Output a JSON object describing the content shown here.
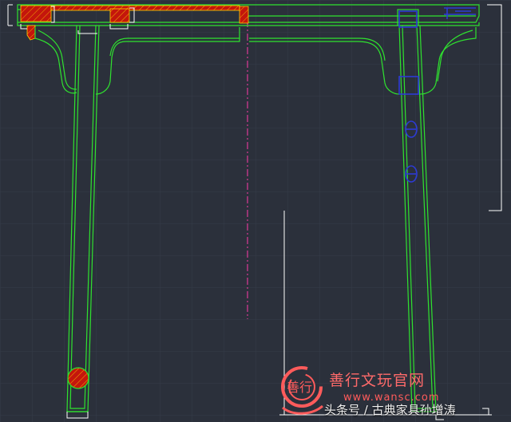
{
  "watermark": {
    "brand": "善行文玩官网",
    "url": "www.wansc.com",
    "logo_text": "善行"
  },
  "credit": "头条号 / 古典家具孙增涛",
  "colors": {
    "background": "#2b303b",
    "grid": "#3a404c",
    "outline": "#2fe22f",
    "hatch_fill": "#c4160c",
    "hatch_line": "#ffd400",
    "centerline": "#ff3aa8",
    "bolt": "#2d3bd6",
    "dimension": "#ffffff"
  }
}
